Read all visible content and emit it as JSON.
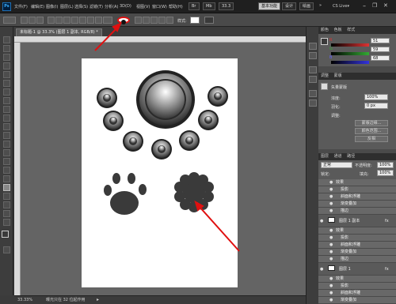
{
  "app": {
    "logo": "Ps",
    "zoom_top": "33.3",
    "workspace_button": "基本功能",
    "design_button": "设计",
    "paint_button": "绘画",
    "cs_live": "CS Live▾"
  },
  "menu": [
    "文件(F)",
    "编辑(E)",
    "图像(I)",
    "图层(L)",
    "选择(S)",
    "滤镜(T)",
    "分析(A)",
    "3D(D)",
    "视图(V)",
    "窗口(W)",
    "帮助(H)"
  ],
  "options": {
    "style_label": "样式:"
  },
  "document": {
    "tab": "未标题-1 @ 33.3% (图层 1 副本, RGB/8) *",
    "zoom": "33.33%",
    "info": "曝光只在 32 位起作用"
  },
  "color_panel": {
    "tabs": [
      "颜色",
      "色板",
      "样式"
    ],
    "labels": [
      "R",
      "G",
      "B"
    ],
    "values": [
      "51",
      "59",
      "68"
    ]
  },
  "adjust_panel": {
    "tabs": [
      "调整",
      "蒙版"
    ],
    "title": "矢量蒙版",
    "density_label": "浓度:",
    "density_value": "100%",
    "feather_label": "羽化:",
    "feather_value": "0 px",
    "refine_label": "调整:",
    "buttons": [
      "蒙版边缘...",
      "颜色范围...",
      "反相"
    ]
  },
  "layers_panel": {
    "tabs": [
      "图层",
      "通道",
      "路径"
    ],
    "blend_mode": "正常",
    "opacity_label": "不透明度:",
    "opacity_value": "100%",
    "lock_label": "锁定:",
    "fill_label": "填充:",
    "fill_value": "100%",
    "rows": [
      {
        "name": "效果",
        "kind": "effects"
      },
      {
        "name": "投影",
        "kind": "fx"
      },
      {
        "name": "斜面和浮雕",
        "kind": "fx"
      },
      {
        "name": "渐变叠加",
        "kind": "fx"
      },
      {
        "name": "描边",
        "kind": "fx"
      },
      {
        "name": "图层 1 副本",
        "kind": "layer"
      },
      {
        "name": "效果",
        "kind": "effects"
      },
      {
        "name": "投影",
        "kind": "fx"
      },
      {
        "name": "斜面和浮雕",
        "kind": "fx"
      },
      {
        "name": "渐变叠加",
        "kind": "fx"
      },
      {
        "name": "描边",
        "kind": "fx"
      },
      {
        "name": "图层 1",
        "kind": "layer"
      },
      {
        "name": "效果",
        "kind": "effects"
      },
      {
        "name": "投影",
        "kind": "fx"
      },
      {
        "name": "斜面和浮雕",
        "kind": "fx"
      },
      {
        "name": "渐变叠加",
        "kind": "fx"
      },
      {
        "name": "描边",
        "kind": "fx"
      }
    ]
  },
  "colors": {
    "shape_fill": "#3a3a3a",
    "annotation_red": "#e01010",
    "selected_layer": "#3d6fb0",
    "swatch_r": "#d33",
    "swatch_g": "#3a3",
    "swatch_b": "#33d"
  }
}
